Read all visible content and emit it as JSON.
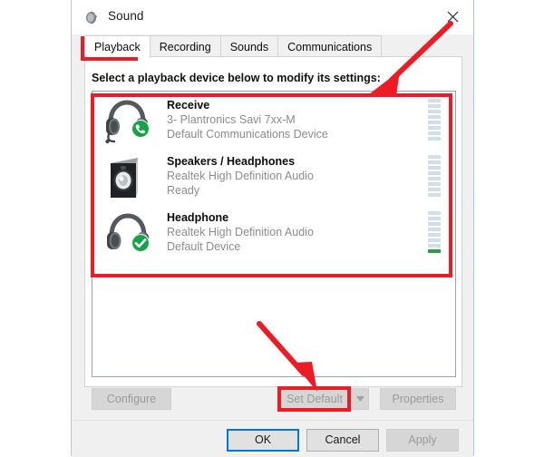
{
  "window": {
    "title": "Sound",
    "icon": "sound-speaker-icon",
    "close_label": "✕"
  },
  "tabs": [
    {
      "label": "Playback",
      "active": true
    },
    {
      "label": "Recording",
      "active": false
    },
    {
      "label": "Sounds",
      "active": false
    },
    {
      "label": "Communications",
      "active": false
    }
  ],
  "panel": {
    "instruction": "Select a playback device below to modify its settings:"
  },
  "devices": [
    {
      "name": "Receive",
      "driver": "3- Plantronics Savi 7xx-M",
      "status": "Default Communications Device",
      "icon": "headset-with-mic-icon",
      "badge": "green-phone-badge",
      "meter_segments": 8,
      "meter_lit": 0
    },
    {
      "name": "Speakers / Headphones",
      "driver": "Realtek High Definition Audio",
      "status": "Ready",
      "icon": "speaker-box-icon",
      "badge": "none",
      "meter_segments": 8,
      "meter_lit": 0
    },
    {
      "name": "Headphone",
      "driver": "Realtek High Definition Audio",
      "status": "Default Device",
      "icon": "headphones-icon",
      "badge": "green-check-badge",
      "meter_segments": 8,
      "meter_lit": 1
    }
  ],
  "actions": {
    "configure": "Configure",
    "set_default": "Set Default",
    "set_default_dropdown": "▼",
    "properties": "Properties"
  },
  "footer": {
    "ok": "OK",
    "cancel": "Cancel",
    "apply": "Apply"
  },
  "annotations": {
    "color": "#ED1C24",
    "highlight_tab": "Playback",
    "highlight_list": "device list",
    "highlight_button": "Set Default",
    "arrow_top": "points to device list",
    "arrow_bottom": "points to Set Default button"
  }
}
